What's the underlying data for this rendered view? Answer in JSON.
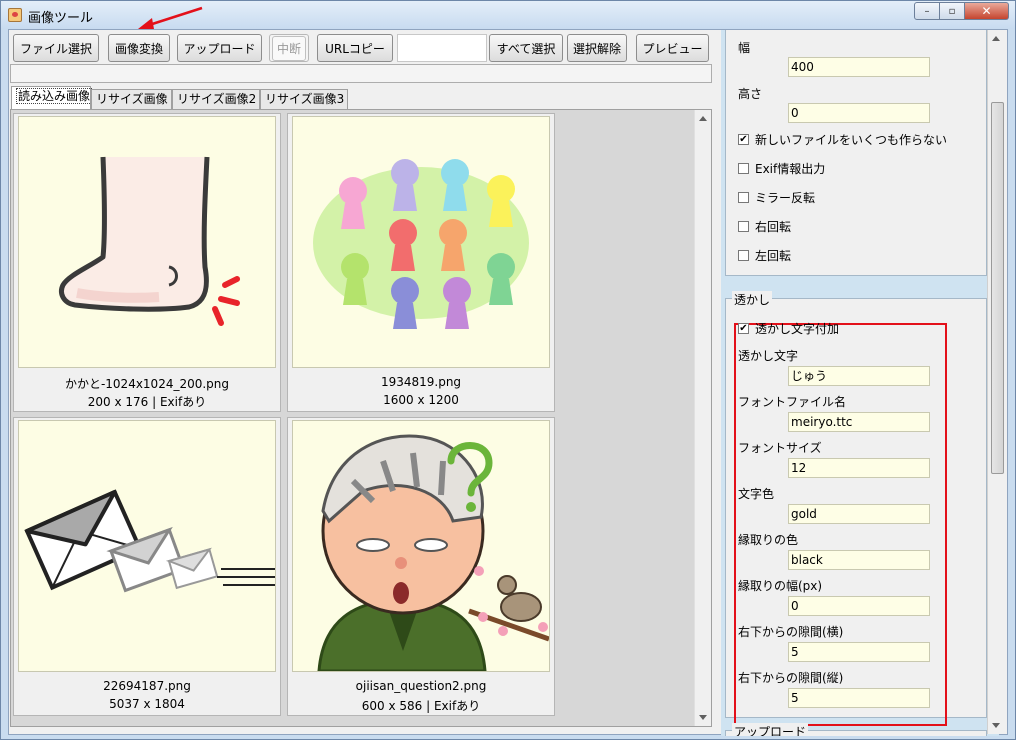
{
  "window": {
    "title": "画像ツール",
    "close_glyph": "✕",
    "max_glyph": "▫",
    "min_glyph": "–"
  },
  "toolbar": {
    "file_select": "ファイル選択",
    "convert": "画像変換",
    "upload": "アップロード",
    "abort": "中断",
    "url_copy": "URLコピー",
    "url_value": "",
    "select_all": "すべて選択",
    "deselect": "選択解除",
    "preview": "プレビュー"
  },
  "tabs": [
    "読み込み画像",
    "リサイズ画像",
    "リサイズ画像2",
    "リサイズ画像3"
  ],
  "images": [
    {
      "name": "かかと-1024x1024_200.png",
      "info": "200 x 176 | Exifあり",
      "icon": "foot-illustration"
    },
    {
      "name": "1934819.png",
      "info": "1600 x 1200",
      "icon": "colored-people-illustration"
    },
    {
      "name": "22694187.png",
      "info": "5037 x 1804",
      "icon": "flying-envelopes-illustration"
    },
    {
      "name": "ojiisan_question2.png",
      "info": "600 x 586 | Exifあり",
      "icon": "old-man-question-illustration"
    }
  ],
  "resize": {
    "width_label": "幅",
    "width_value": "400",
    "height_label": "高さ",
    "height_value": "0",
    "no_multi_label": "新しいファイルをいくつも作らない",
    "no_multi_checked": true,
    "exif_label": "Exif情報出力",
    "mirror_label": "ミラー反転",
    "rotate_right_label": "右回転",
    "rotate_left_label": "左回転"
  },
  "watermark": {
    "group_title": "透かし",
    "enable_label": "透かし文字付加",
    "enable_checked": true,
    "text_label": "透かし文字",
    "text_value": "じゅう",
    "font_file_label": "フォントファイル名",
    "font_file_value": "meiryo.ttc",
    "font_size_label": "フォントサイズ",
    "font_size_value": "12",
    "color_label": "文字色",
    "color_value": "gold",
    "outline_color_label": "縁取りの色",
    "outline_color_value": "black",
    "outline_width_label": "縁取りの幅(px)",
    "outline_width_value": "0",
    "offset_x_label": "右下からの隙間(横)",
    "offset_x_value": "5",
    "offset_y_label": "右下からの隙間(縦)",
    "offset_y_value": "5"
  },
  "next_group_title": "アップロード",
  "colors": {
    "highlight": "#e3101a",
    "field_bg": "#fefee6",
    "panel_bg": "#cfe3f1"
  }
}
